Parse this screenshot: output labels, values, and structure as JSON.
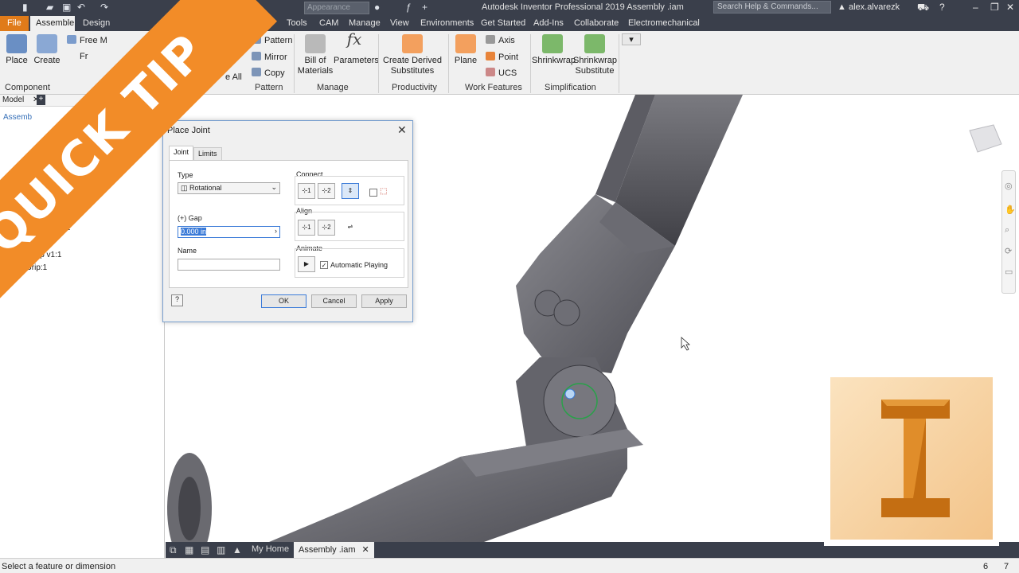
{
  "titlebar": {
    "style_placeholder": "Appearance",
    "title": "Autodesk Inventor Professional 2019    Assembly .iam",
    "search_placeholder": "Search Help & Commands...",
    "user": "alex.alvarezk"
  },
  "menu": {
    "file": "File",
    "tabs": [
      "Assemble",
      "Design",
      "Tools",
      "CAM",
      "Manage",
      "View",
      "Environments",
      "Get Started",
      "Add-Ins",
      "Collaborate",
      "Electromechanical"
    ]
  },
  "ribbon": {
    "place": "Place",
    "create": "Create",
    "free_move": "Free M",
    "fr": "Fr",
    "component_group": "Component",
    "pattern": "Pattern",
    "mirror": "Mirror",
    "copy": "Copy",
    "pattern_group": "Pattern",
    "bill_of_materials_1": "Bill of",
    "bill_of_materials_2": "Materials",
    "parameters": "Parameters",
    "manage_group": "Manage",
    "create_derived_1": "Create Derived",
    "create_derived_2": "Substitutes",
    "productivity_group": "Productivity",
    "plane": "Plane",
    "axis": "Axis",
    "point": "Point",
    "ucs": "UCS",
    "work_features_group": "Work Features",
    "shrinkwrap": "Shrinkwrap",
    "shrinkwrap_sub_1": "Shrinkwrap",
    "shrinkwrap_sub_2": "Substitute",
    "simplification_group": "Simplification",
    "all": "e All"
  },
  "browser": {
    "tab": "Model",
    "assembly": "Assemb",
    "item1": ":1",
    "item2": "ip v1:1",
    "item3": "Grip:1"
  },
  "dialog": {
    "title": "Place Joint",
    "tabs": [
      "Joint",
      "Limits"
    ],
    "type_label": "Type",
    "type_value": "Rotational",
    "gap_label": "Gap",
    "gap_value": "0.000 in",
    "name_label": "Name",
    "name_value": "",
    "connect_label": "Connect",
    "align_label": "Align",
    "animate_label": "Animate",
    "automatic_playing": "Automatic Playing",
    "ok": "OK",
    "cancel": "Cancel",
    "apply": "Apply"
  },
  "doctabs": {
    "home": "My Home",
    "active": "Assembly .iam"
  },
  "status": {
    "text": "Select a feature or dimension",
    "n1": "6",
    "n2": "7"
  },
  "banner": {
    "text": "QUICK TIP"
  },
  "colors": {
    "accent": "#f28c28",
    "chrome": "#3a3f4b",
    "file": "#e07b1a"
  }
}
